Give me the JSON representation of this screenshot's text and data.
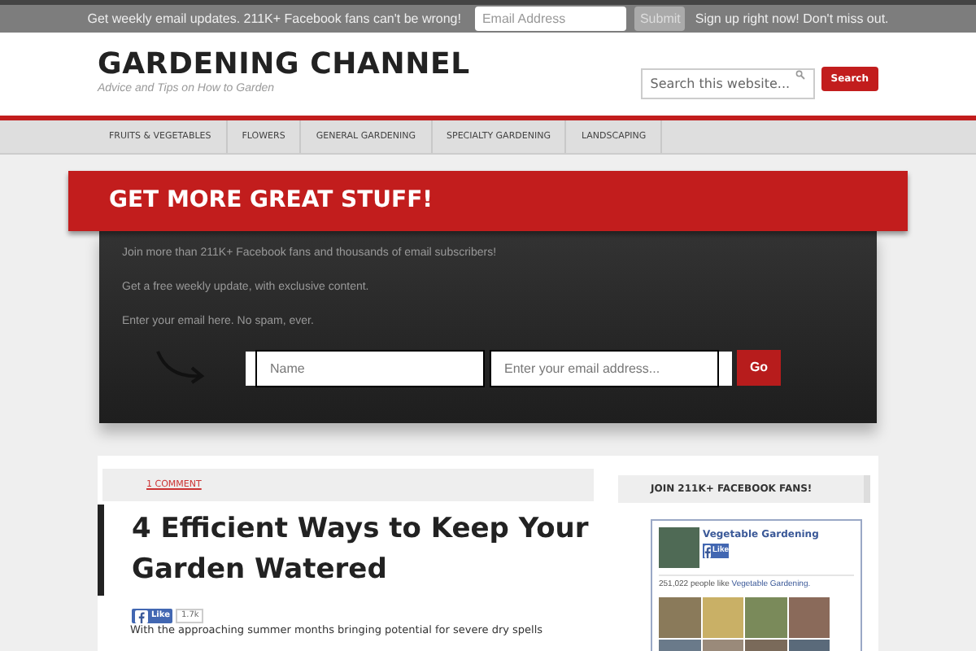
{
  "top_bar": {
    "message": "Get weekly email updates. 211K+ Facebook fans can't be wrong!",
    "email": {
      "placeholder": "Email Address"
    },
    "submit": "Submit",
    "tagline": "Sign up right now! Don't miss out."
  },
  "header": {
    "title": "GARDENING CHANNEL",
    "subtitle": "Advice and Tips on How to Garden",
    "search": {
      "placeholder": "Search this website..."
    },
    "search_button": "Search"
  },
  "nav": {
    "items": [
      {
        "label": "FRUITS & VEGETABLES"
      },
      {
        "label": "FLOWERS"
      },
      {
        "label": "GENERAL GARDENING"
      },
      {
        "label": "SPECIALTY GARDENING"
      },
      {
        "label": "LANDSCAPING"
      }
    ]
  },
  "optin": {
    "title": "GET MORE GREAT STUFF!",
    "lines": [
      "Join more than 211K+ Facebook fans and thousands of email subscribers!",
      "Get a free weekly update, with exclusive content.",
      "Enter your email here. No spam, ever."
    ],
    "name": {
      "placeholder": "Name"
    },
    "email": {
      "placeholder": "Enter your email address..."
    },
    "button": "Go"
  },
  "article": {
    "comments": "1 COMMENT",
    "title": "4 Efficient Ways to Keep Your Garden Watered",
    "like": "Like",
    "like_count": "1.7k",
    "excerpt": "With the approaching summer months bringing potential for severe dry spells"
  },
  "sidebar": {
    "heading": "JOIN 211K+ FACEBOOK FANS!",
    "page_name": "Vegetable Gardening",
    "like": "Like",
    "fans_count": "251,022 people like",
    "fans_link": "Vegetable Gardening."
  }
}
